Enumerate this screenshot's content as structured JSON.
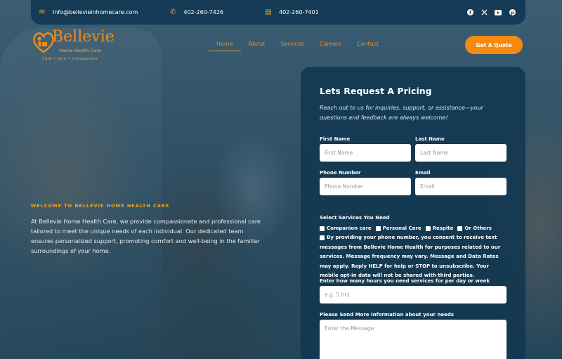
{
  "topbar": {
    "email": "Info@bellevieinhomecare.com",
    "phone": "402-260-7426",
    "fax": "402-260-7401",
    "social": [
      "facebook-icon",
      "x-icon",
      "youtube-icon",
      "pinterest-icon"
    ]
  },
  "logo": {
    "name": "Bellevie",
    "subtitle": "Home Health Care",
    "tagline": "Care • love • Compassion"
  },
  "nav": {
    "items": [
      "Home",
      "About",
      "Services",
      "Careers",
      "Contact"
    ],
    "active": "Home",
    "cta": "Get A Quote"
  },
  "hero": {
    "eyebrow": "WELCOME TO BELLEVIE HOME HEALTH CARE",
    "body": "At Bellevie Home Health Care, we provide compassionate and professional care tailored to meet the unique needs of each individual. Our dedicated team ensures personalized support, promoting comfort and well-being in the familiar surroundings of your home."
  },
  "form": {
    "title": "Lets Request A Pricing",
    "lead": "Reach out to us for inquiries, support, or assistance—your questions and feedback are always welcome!",
    "first_name_label": "First Name",
    "first_name_placeholder": "First Name",
    "last_name_label": "Last Name",
    "last_name_placeholder": "Last Name",
    "phone_label": "Phone Number",
    "phone_placeholder": "Phone Number",
    "email_label": "Email",
    "email_placeholder": "Email",
    "services_label": "Select Services You Need",
    "services": [
      "Companion care",
      "Personal Care",
      "Respite",
      "Or Others"
    ],
    "consent": "By providing your phone number, you consent to receive text messages from Bellevie Home Health for purposes related to our services. Message frequency may vary. Message and Data Rates may apply. Reply HELP for help or STOP to unsubscribe. Your mobile opt-in data will not be shared with third parties.",
    "hours_label": "Enter how many hours you need services for per day or week",
    "hours_placeholder": "e.g. 5 hrs",
    "message_label": "Please Send More Information about your needs",
    "message_placeholder": "Enter the Message"
  },
  "colors": {
    "accent": "#f58a12",
    "topbar": "#143a55",
    "card": "#113750"
  }
}
